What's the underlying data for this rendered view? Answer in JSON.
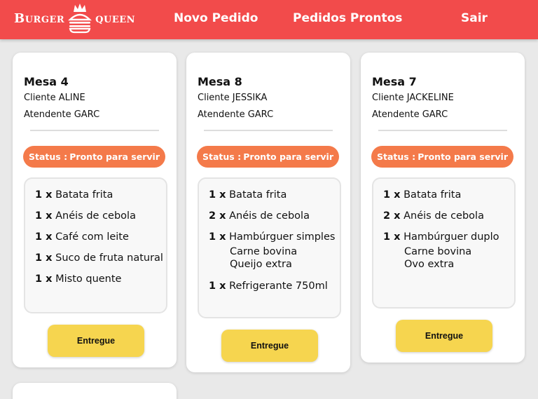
{
  "header": {
    "logo_left": "Burger",
    "logo_right": "queen",
    "nav": [
      "Novo Pedido",
      "Pedidos Prontos",
      "Sair"
    ]
  },
  "colors": {
    "header": "#f24b4b",
    "status": "#f47a4a",
    "button": "#f6d54f",
    "background": "#e9e9e9"
  },
  "orders": [
    {
      "title": "Mesa 4",
      "client": "Cliente ALINE",
      "attendant": "Atendente GARC",
      "status_label": "Status :",
      "status_value": "Pronto para servir",
      "items": [
        {
          "qty": "1 x",
          "name": "Batata frita",
          "subs": []
        },
        {
          "qty": "1 x",
          "name": "Anéis de cebola",
          "subs": []
        },
        {
          "qty": "1 x",
          "name": "Café com leite",
          "subs": []
        },
        {
          "qty": "1 x",
          "name": "Suco de fruta natural",
          "subs": []
        },
        {
          "qty": "1 x",
          "name": "Misto quente",
          "subs": []
        }
      ],
      "button": "Entregue"
    },
    {
      "title": "Mesa 8",
      "client": "Cliente JESSIKA",
      "attendant": "Atendente GARC",
      "status_label": "Status :",
      "status_value": "Pronto para servir",
      "items": [
        {
          "qty": "1 x",
          "name": "Batata frita",
          "subs": []
        },
        {
          "qty": "2 x",
          "name": "Anéis de cebola",
          "subs": []
        },
        {
          "qty": "1 x",
          "name": "Hambúrguer simples",
          "subs": [
            "Carne bovina",
            "Queijo extra"
          ]
        },
        {
          "qty": "1 x",
          "name": "Refrigerante 750ml",
          "subs": []
        }
      ],
      "button": "Entregue"
    },
    {
      "title": "Mesa 7",
      "client": "Cliente JACKELINE",
      "attendant": "Atendente GARC",
      "status_label": "Status :",
      "status_value": "Pronto para servir",
      "items": [
        {
          "qty": "1 x",
          "name": "Batata frita",
          "subs": []
        },
        {
          "qty": "2 x",
          "name": "Anéis de cebola",
          "subs": []
        },
        {
          "qty": "1 x",
          "name": "Hambúrguer duplo",
          "subs": [
            "Carne bovina",
            "Ovo extra"
          ]
        }
      ],
      "button": "Entregue"
    }
  ]
}
